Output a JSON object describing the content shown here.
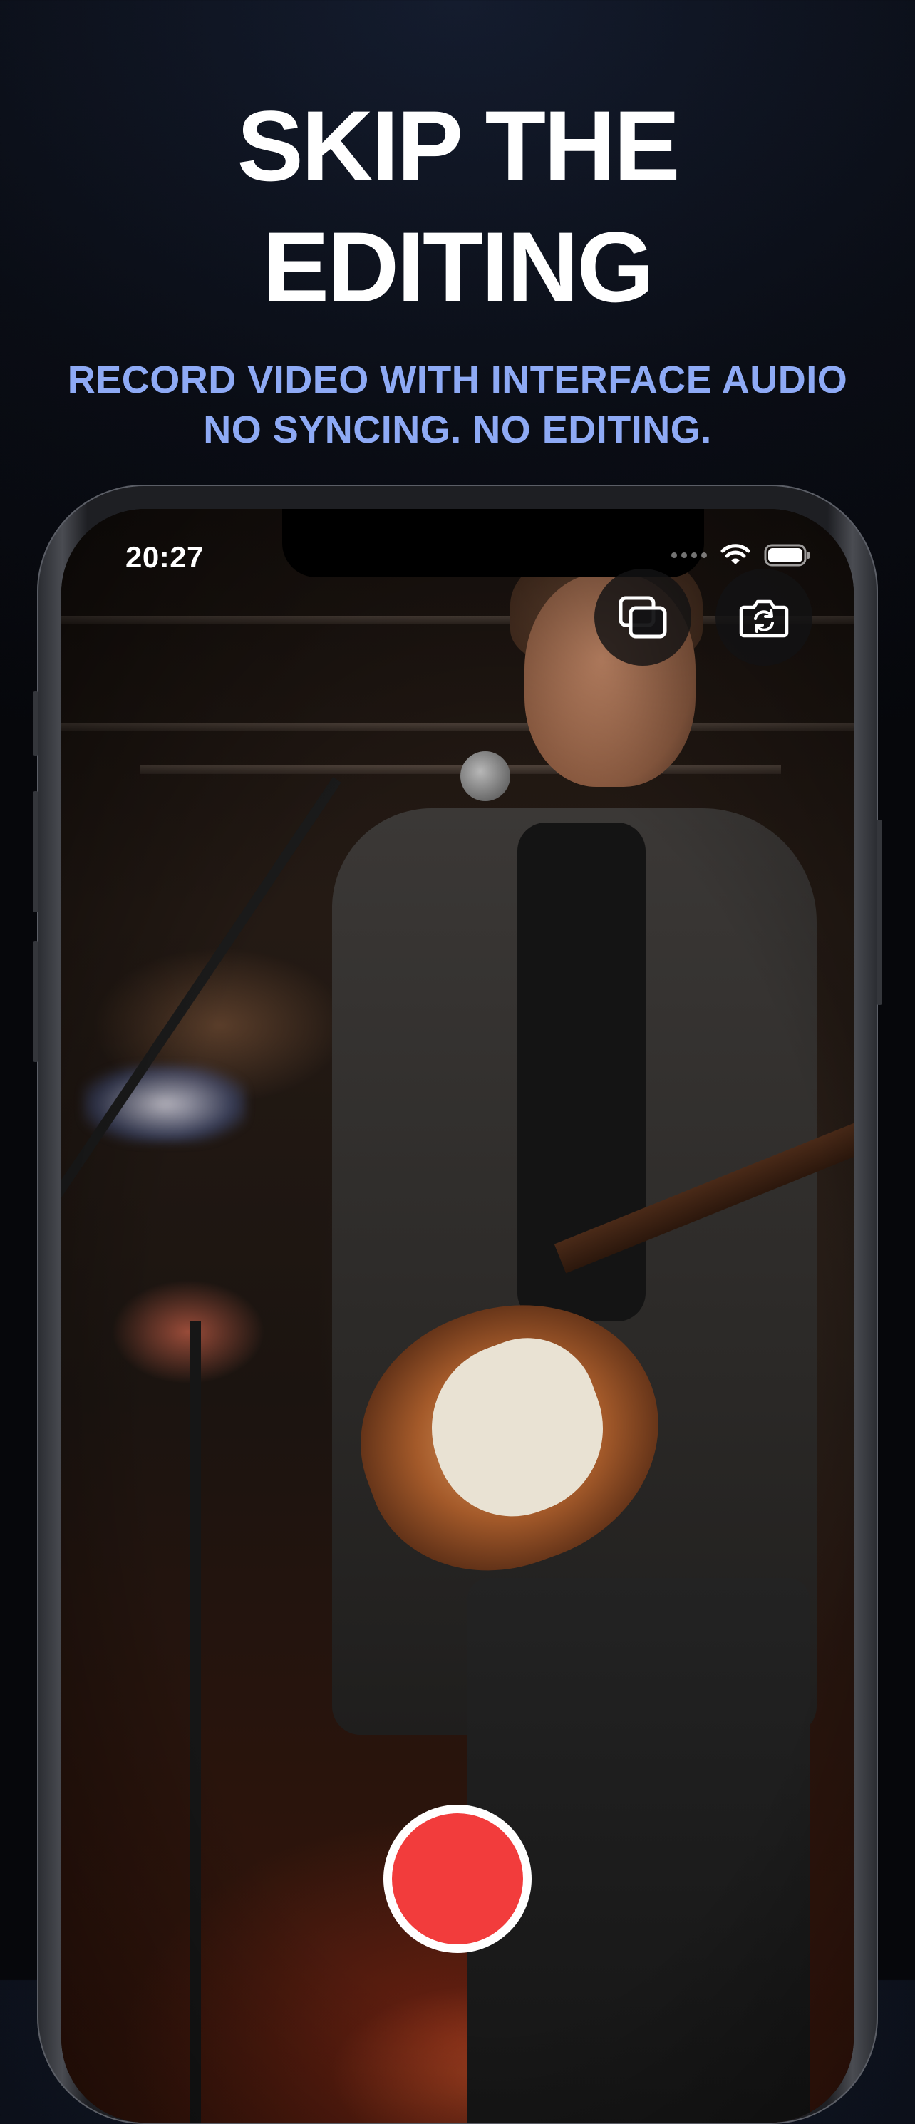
{
  "headline": {
    "line1": "SKIP THE",
    "line2": "EDITING"
  },
  "subheadline": {
    "line1": "RECORD VIDEO WITH INTERFACE AUDIO",
    "line2": "NO SYNCING. NO EDITING."
  },
  "phone": {
    "status_bar": {
      "time": "20:27",
      "icons": [
        "cellular-dots-icon",
        "wifi-icon",
        "battery-icon"
      ]
    },
    "camera_preview": {
      "scene": "musician singing into microphone while playing electric guitar on stage"
    },
    "controls": {
      "top": [
        "switch-view-icon",
        "flip-camera-icon"
      ],
      "record": "record-button"
    }
  },
  "colors": {
    "background": "#0a0d15",
    "headline": "#ffffff",
    "subheadline": "#8eaaf5",
    "record": "#f23c3c"
  }
}
